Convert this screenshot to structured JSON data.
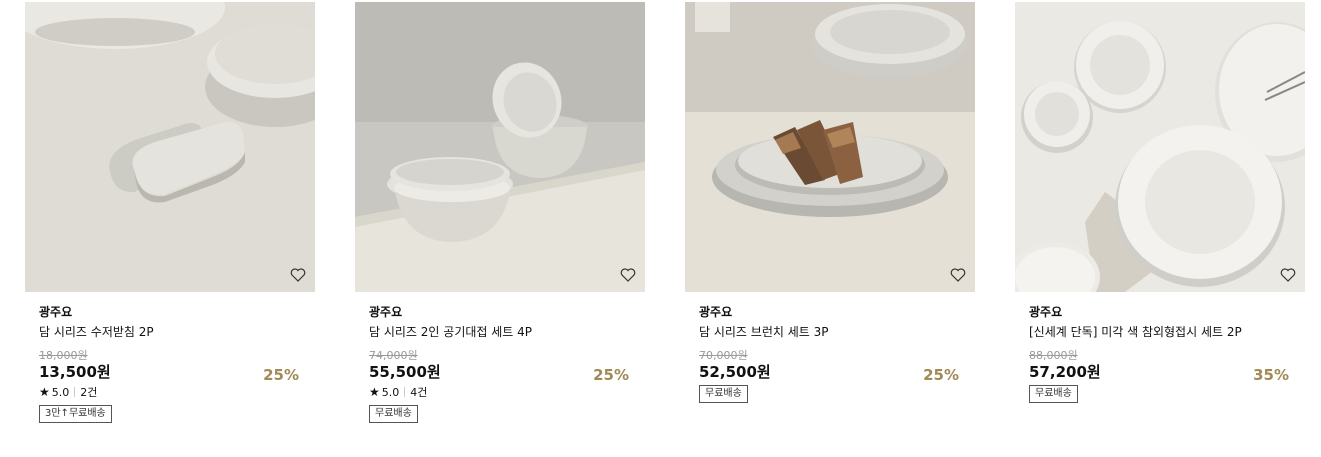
{
  "products": [
    {
      "brand": "광주요",
      "name": "담 시리즈 수저받침 2P",
      "original_price": "18,000원",
      "price": "13,500원",
      "discount": "25%",
      "rating": "5.0",
      "reviews": "2건",
      "badge": "3만↑무료배송",
      "image": "spoon-rest-photo"
    },
    {
      "brand": "광주요",
      "name": "담 시리즈 2인 공기대접 세트 4P",
      "original_price": "74,000원",
      "price": "55,500원",
      "discount": "25%",
      "rating": "5.0",
      "reviews": "4건",
      "badge": "무료배송",
      "image": "bowl-set-photo"
    },
    {
      "brand": "광주요",
      "name": "담 시리즈 브런치 세트 3P",
      "original_price": "70,000원",
      "price": "52,500원",
      "discount": "25%",
      "badge": "무료배송",
      "image": "brunch-set-photo"
    },
    {
      "brand": "광주요",
      "name": "[신세계 단독] 미각 색 참외형접시 세트 2P",
      "original_price": "88,000원",
      "price": "57,200원",
      "discount": "35%",
      "badge": "무료배송",
      "image": "plate-set-photo"
    }
  ],
  "colors": {
    "discount": "#a08a55",
    "strike": "#9a9a9a"
  },
  "icons": {
    "wishlist": "heart-outline-icon",
    "rating": "star-icon"
  }
}
